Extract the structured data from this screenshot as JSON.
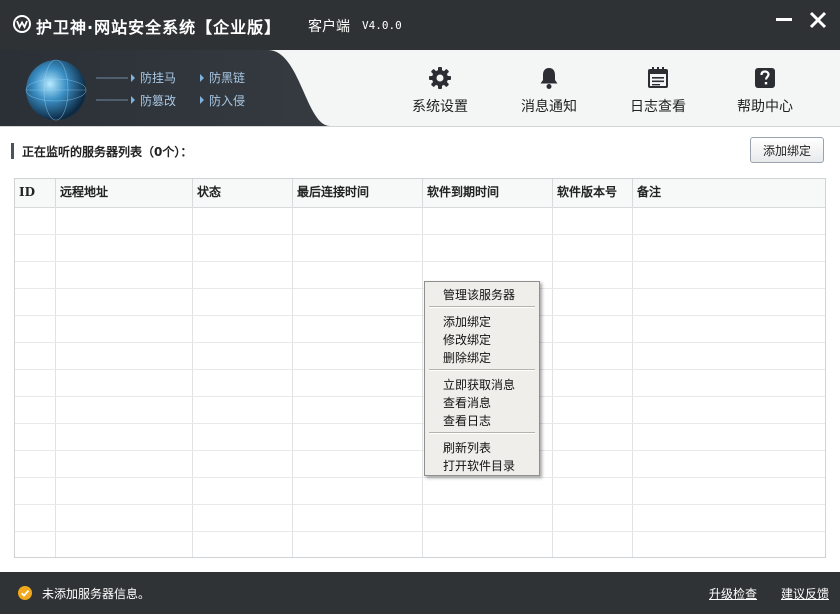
{
  "window": {
    "title_main": "护卫神·网站安全系统【企业版】",
    "title_sub": "客户端",
    "version": "V4.0.0"
  },
  "banner": {
    "features": [
      "防挂马",
      "防黑链",
      "防篡改",
      "防入侵"
    ]
  },
  "toolbar": {
    "settings": "系统设置",
    "messages": "消息通知",
    "logs": "日志查看",
    "help": "帮助中心"
  },
  "section": {
    "title": "正在监听的服务器列表（0个）：",
    "add_button": "添加绑定"
  },
  "table": {
    "columns": [
      "ID",
      "远程地址",
      "状态",
      "最后连接时间",
      "软件到期时间",
      "软件版本号",
      "备注"
    ],
    "rows": []
  },
  "context_menu": {
    "items": [
      "管理该服务器",
      "添加绑定",
      "修改绑定",
      "删除绑定",
      "立即获取消息",
      "查看消息",
      "查看日志",
      "刷新列表",
      "打开软件目录"
    ]
  },
  "status": {
    "text": "未添加服务器信息。",
    "upgrade": "升级检查",
    "feedback": "建议反馈"
  },
  "colors": {
    "titlebar": "#2f3234",
    "statusbar": "#303336",
    "banner_text": "#a9c7e4",
    "status_icon": "#f0a81c"
  }
}
